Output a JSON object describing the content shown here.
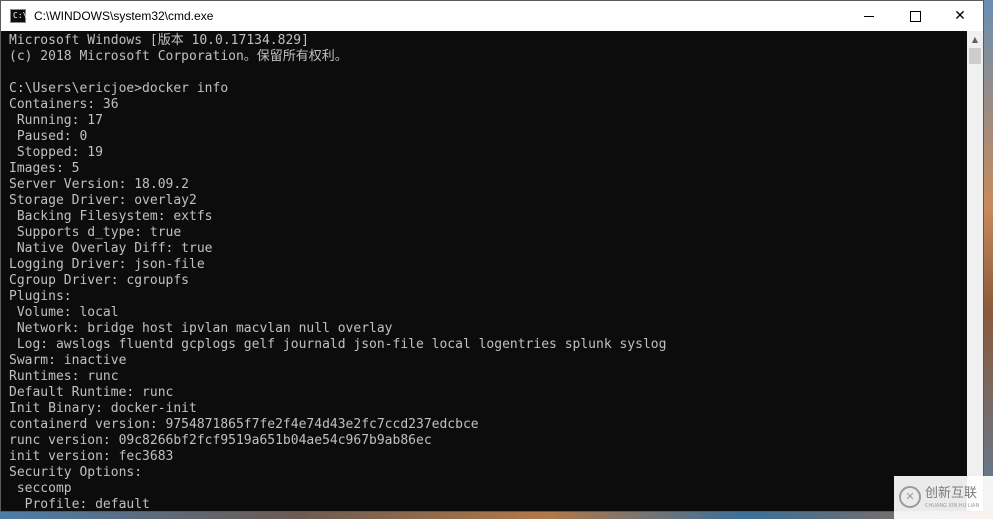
{
  "window": {
    "title": "C:\\WINDOWS\\system32\\cmd.exe",
    "app_icon_text": "C:\\",
    "controls": {
      "minimize": "minimize-icon",
      "maximize": "maximize-icon",
      "close": "✕"
    }
  },
  "console": {
    "lines": [
      "Microsoft Windows [版本 10.0.17134.829]",
      "(c) 2018 Microsoft Corporation。保留所有权利。",
      "",
      "C:\\Users\\ericjoe>docker info",
      "Containers: 36",
      " Running: 17",
      " Paused: 0",
      " Stopped: 19",
      "Images: 5",
      "Server Version: 18.09.2",
      "Storage Driver: overlay2",
      " Backing Filesystem: extfs",
      " Supports d_type: true",
      " Native Overlay Diff: true",
      "Logging Driver: json-file",
      "Cgroup Driver: cgroupfs",
      "Plugins:",
      " Volume: local",
      " Network: bridge host ipvlan macvlan null overlay",
      " Log: awslogs fluentd gcplogs gelf journald json-file local logentries splunk syslog",
      "Swarm: inactive",
      "Runtimes: runc",
      "Default Runtime: runc",
      "Init Binary: docker-init",
      "containerd version: 9754871865f7fe2f4e74d43e2fc7ccd237edcbce",
      "runc version: 09c8266bf2fcf9519a651b04ae54c967b9ab86ec",
      "init version: fec3683",
      "Security Options:",
      " seccomp",
      "  Profile: default"
    ]
  },
  "scrollbar": {
    "up_arrow": "▲"
  },
  "watermark": {
    "logo": "✕",
    "text": "创新互联",
    "subtext": "CHUANG XIN HU LIAN"
  },
  "colors": {
    "console_bg": "#0c0c0c",
    "console_fg": "#c0c0c0",
    "titlebar_bg": "#ffffff"
  }
}
